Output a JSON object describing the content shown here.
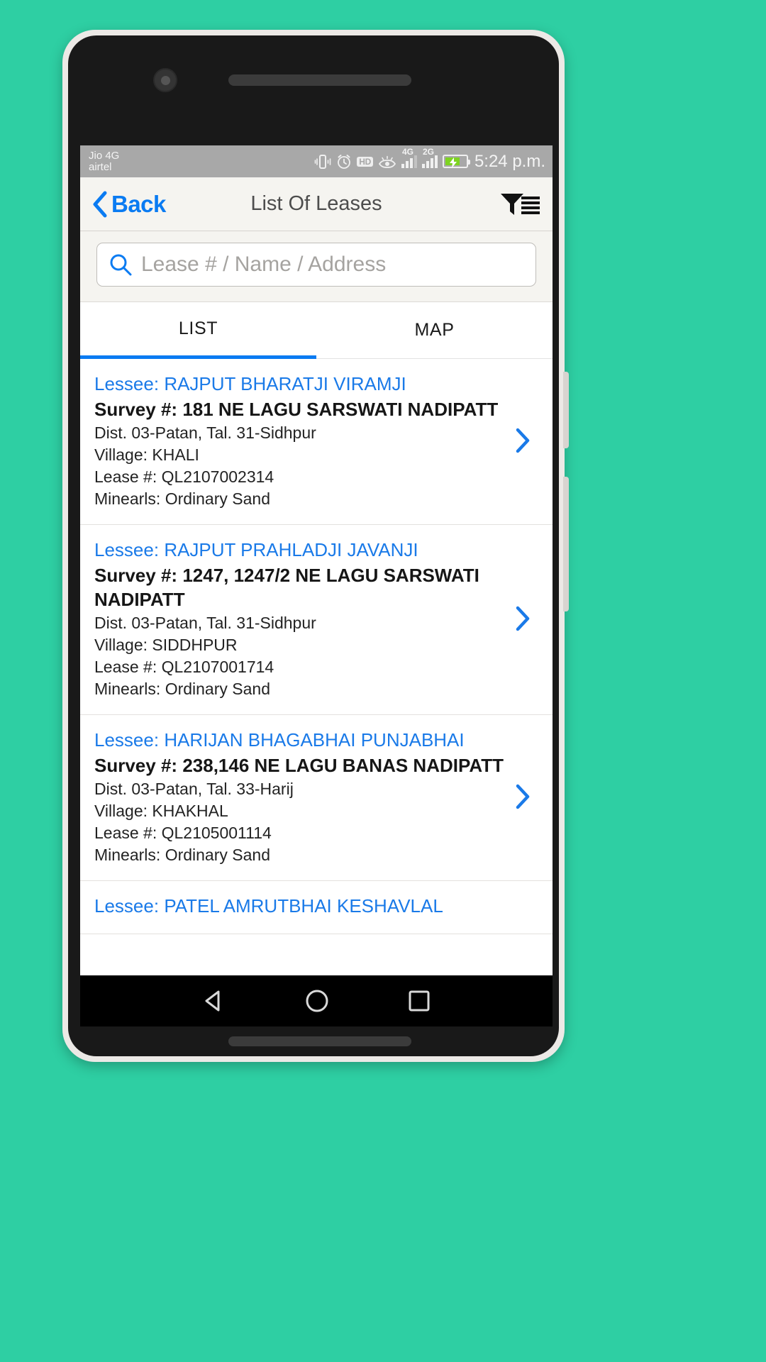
{
  "status_bar": {
    "carrier_primary": "Jio 4G",
    "carrier_secondary": "airtel",
    "time": "5:24 p.m.",
    "icons": [
      "vibrate-icon",
      "alarm-icon",
      "hd-icon",
      "eye-icon",
      "signal-4g-icon",
      "signal-2g-icon",
      "battery-charging-icon"
    ],
    "hd_label": "HD",
    "signal_primary_label": "4G",
    "signal_secondary_label": "2G"
  },
  "header": {
    "back_label": "Back",
    "title": "List Of Leases",
    "filter_icon": "filter-list-icon",
    "accent_color": "#0a7bf2"
  },
  "search": {
    "placeholder": "Lease # / Name / Address",
    "value": "",
    "icon": "search-icon"
  },
  "tabs": [
    {
      "label": "LIST",
      "active": true
    },
    {
      "label": "MAP",
      "active": false
    }
  ],
  "leases": [
    {
      "lessee_label": "Lessee:",
      "lessee_name": "RAJPUT BHARATJI VIRAMJI",
      "survey_label": "Survey #:",
      "survey_value": "181 NE LAGU SARSWATI NADIPATT",
      "district": "Dist. 03-Patan, Tal. 31-Sidhpur",
      "village": "Village: KHALI",
      "lease_no": "Lease #: QL2107002314",
      "minerals": "Minearls: Ordinary Sand",
      "chevron": "chevron-right-icon"
    },
    {
      "lessee_label": "Lessee:",
      "lessee_name": "RAJPUT PRAHLADJI JAVANJI",
      "survey_label": "Survey #:",
      "survey_value": "1247, 1247/2 NE LAGU SARSWATI NADIPATT",
      "district": "Dist. 03-Patan, Tal. 31-Sidhpur",
      "village": "Village: SIDDHPUR",
      "lease_no": "Lease #: QL2107001714",
      "minerals": "Minearls: Ordinary Sand",
      "chevron": "chevron-right-icon"
    },
    {
      "lessee_label": "Lessee:",
      "lessee_name": "HARIJAN BHAGABHAI PUNJABHAI",
      "survey_label": "Survey #:",
      "survey_value": "238,146 NE LAGU BANAS NADIPATT",
      "district": "Dist. 03-Patan, Tal. 33-Harij",
      "village": "Village: KHAKHAL",
      "lease_no": "Lease #: QL2105001114",
      "minerals": "Minearls: Ordinary Sand",
      "chevron": "chevron-right-icon"
    },
    {
      "lessee_label": "Lessee:",
      "lessee_name": "PATEL AMRUTBHAI KESHAVLAL",
      "survey_label": "",
      "survey_value": "",
      "district": "",
      "village": "",
      "lease_no": "",
      "minerals": "",
      "chevron": "chevron-right-icon"
    }
  ],
  "android_nav": {
    "back": "triangle-back-icon",
    "home": "circle-home-icon",
    "recents": "square-recents-icon"
  }
}
